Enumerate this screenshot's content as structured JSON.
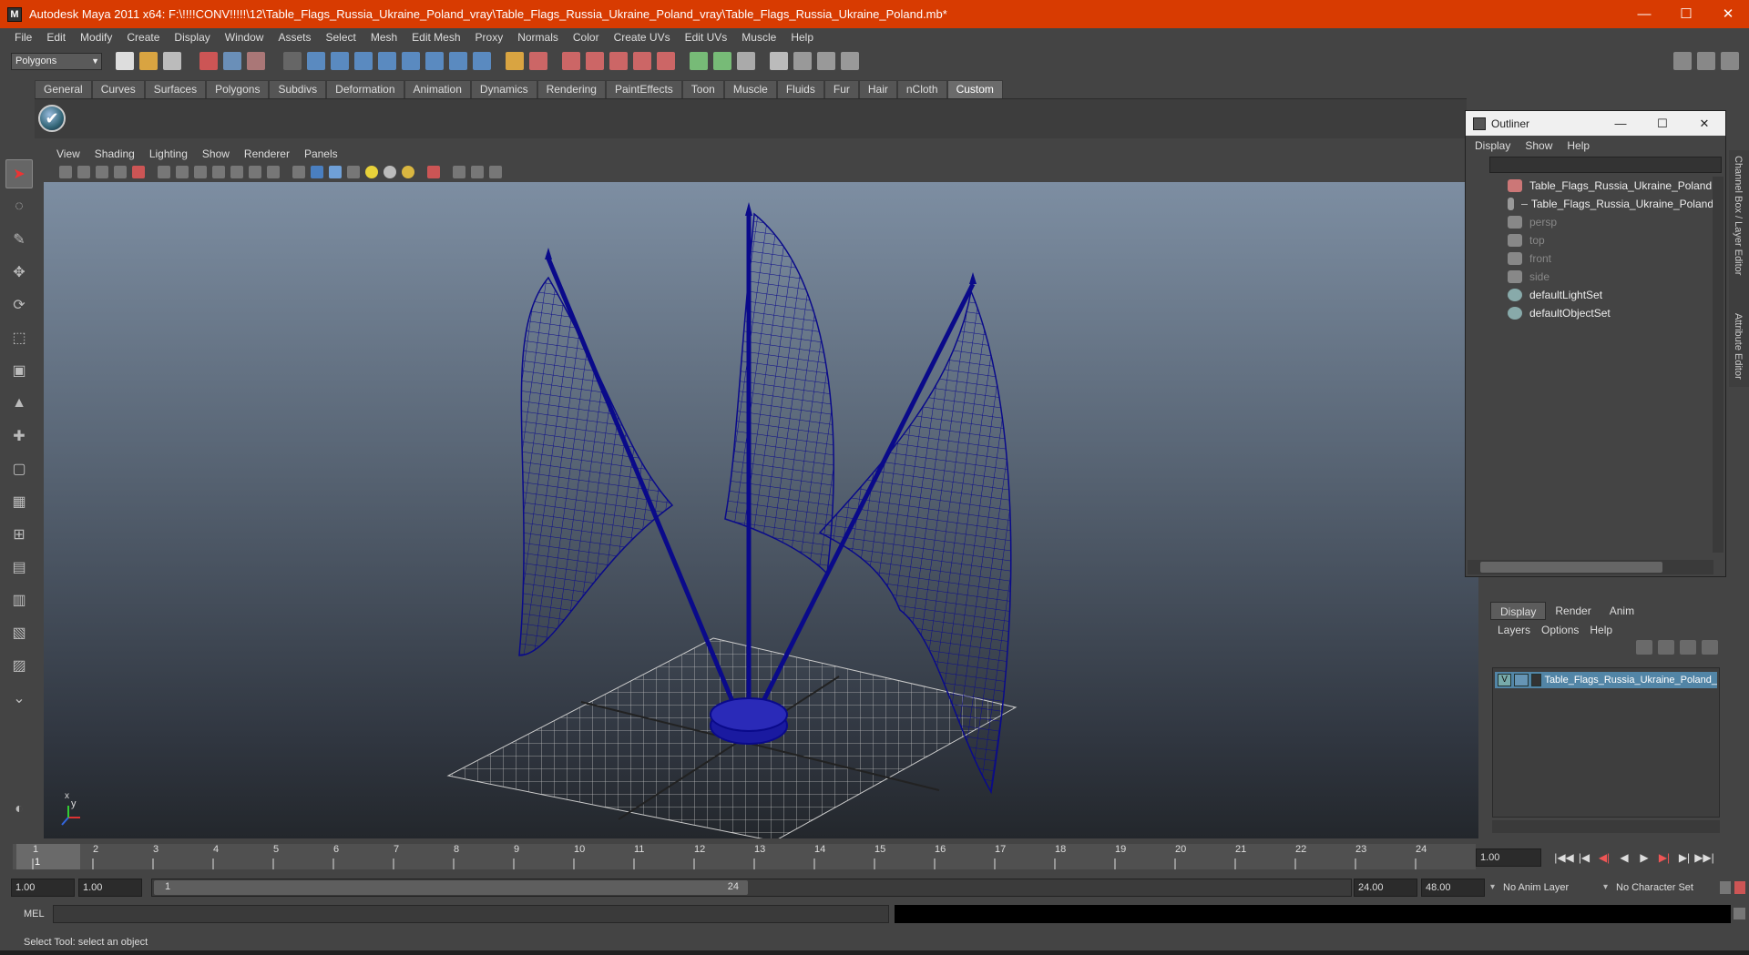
{
  "window": {
    "title": "Autodesk Maya 2011 x64: F:\\!!!!CONV!!!!!\\12\\Table_Flags_Russia_Ukraine_Poland_vray\\Table_Flags_Russia_Ukraine_Poland_vray\\Table_Flags_Russia_Ukraine_Poland.mb*",
    "icon": "M",
    "minimize_glyph": "—",
    "maximize_glyph": "☐",
    "close_glyph": "✕"
  },
  "menubar": [
    "File",
    "Edit",
    "Modify",
    "Create",
    "Display",
    "Window",
    "Assets",
    "Select",
    "Mesh",
    "Edit Mesh",
    "Proxy",
    "Normals",
    "Color",
    "Create UVs",
    "Edit UVs",
    "Muscle",
    "Help"
  ],
  "statusline": {
    "mode": "Polygons"
  },
  "shelf": {
    "tabs": [
      "General",
      "Curves",
      "Surfaces",
      "Polygons",
      "Subdivs",
      "Deformation",
      "Animation",
      "Dynamics",
      "Rendering",
      "PaintEffects",
      "Toon",
      "Muscle",
      "Fluids",
      "Fur",
      "Hair",
      "nCloth",
      "Custom"
    ],
    "active_tab": "Custom",
    "icon_glyph": "✔"
  },
  "panel": {
    "menus": [
      "View",
      "Shading",
      "Lighting",
      "Show",
      "Renderer",
      "Panels"
    ],
    "axis": {
      "x": "x",
      "y": "y"
    }
  },
  "outliner": {
    "title": "Outliner",
    "menus": [
      "Display",
      "Show",
      "Help"
    ],
    "items": [
      {
        "label": "Table_Flags_Russia_Ukraine_Poland",
        "dim": false,
        "indent": 0
      },
      {
        "label": "Table_Flags_Russia_Ukraine_Poland",
        "dim": false,
        "indent": 1
      },
      {
        "label": "persp",
        "dim": true,
        "indent": 0
      },
      {
        "label": "top",
        "dim": true,
        "indent": 0
      },
      {
        "label": "front",
        "dim": true,
        "indent": 0
      },
      {
        "label": "side",
        "dim": true,
        "indent": 0
      },
      {
        "label": "defaultLightSet",
        "dim": false,
        "indent": 0
      },
      {
        "label": "defaultObjectSet",
        "dim": false,
        "indent": 0
      }
    ]
  },
  "side_tabs": [
    "Channel Box / Layer Editor",
    "Attribute Editor"
  ],
  "layer_editor": {
    "tabs": [
      "Display",
      "Render",
      "Anim"
    ],
    "active_tab": "Display",
    "menus": [
      "Layers",
      "Options",
      "Help"
    ],
    "layer": {
      "visible": "V",
      "name": "Table_Flags_Russia_Ukraine_Poland_"
    }
  },
  "time_slider": {
    "ticks": [
      "1",
      "2",
      "3",
      "4",
      "5",
      "6",
      "7",
      "8",
      "9",
      "10",
      "11",
      "12",
      "13",
      "14",
      "15",
      "16",
      "17",
      "18",
      "19",
      "20",
      "21",
      "22",
      "23",
      "24"
    ],
    "current_frame": "1",
    "current_time_field": "1.00",
    "playback_glyphs": [
      "|◀◀",
      "|◀",
      "◀|",
      "◀",
      "▶",
      "▶|",
      "▶|",
      "▶▶|"
    ]
  },
  "range_slider": {
    "start_field": "1.00",
    "inner_start_field": "1.00",
    "range_start": "1",
    "range_end": "24",
    "end_field": "24.00",
    "outer_end_field": "48.00",
    "anim_layer": "No Anim Layer",
    "character_set": "No Character Set"
  },
  "command_line": {
    "label": "MEL"
  },
  "help_line": {
    "text": "Select Tool: select an object"
  },
  "colors": {
    "title_bar": "#d83b01",
    "wireframe": "#0a0a8a",
    "selected_layer": "#5285a6"
  }
}
